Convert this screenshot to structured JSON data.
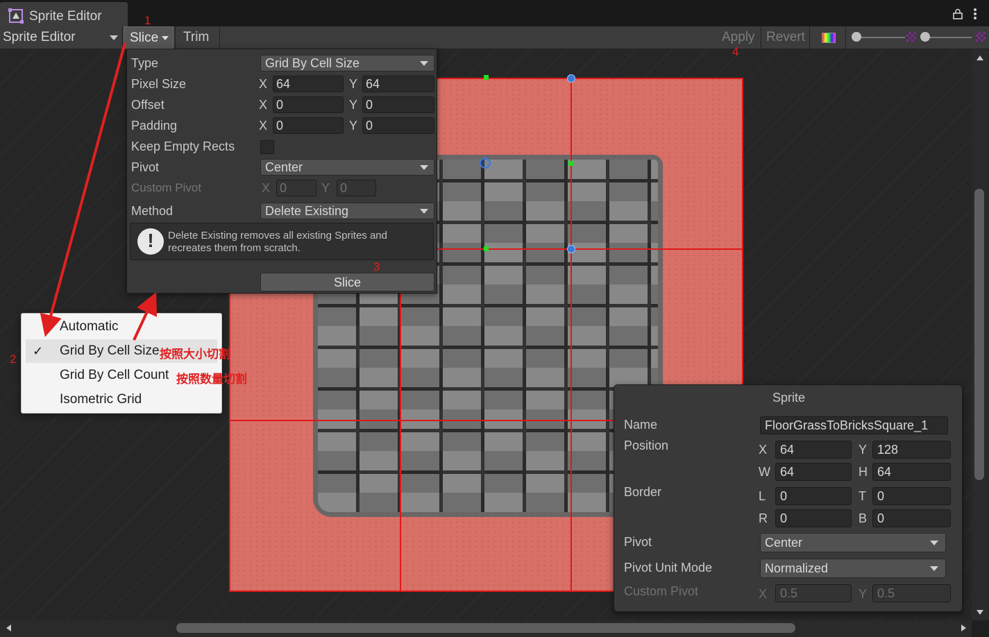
{
  "window": {
    "title": "Sprite Editor",
    "title_icon": "sprite-editor-icon",
    "lock_icon": "lock-icon",
    "more_icon": "more-vertical-icon"
  },
  "toolbar": {
    "mode": "Sprite Editor",
    "slice_label": "Slice",
    "trim_label": "Trim",
    "apply_label": "Apply",
    "revert_label": "Revert",
    "color_icon": "color-channel-icon",
    "mip_icon": "mipmap-icon"
  },
  "slice_panel": {
    "type_label": "Type",
    "type_value": "Grid By Cell Size",
    "pixel_size_label": "Pixel Size",
    "pixel_size": {
      "x_label": "X",
      "x": "64",
      "y_label": "Y",
      "y": "64"
    },
    "offset_label": "Offset",
    "offset": {
      "x_label": "X",
      "x": "0",
      "y_label": "Y",
      "y": "0"
    },
    "padding_label": "Padding",
    "padding": {
      "x_label": "X",
      "x": "0",
      "y_label": "Y",
      "y": "0"
    },
    "keep_empty_label": "Keep Empty Rects",
    "keep_empty_checked": false,
    "pivot_label": "Pivot",
    "pivot_value": "Center",
    "custom_pivot_label": "Custom Pivot",
    "custom_pivot": {
      "x_label": "X",
      "x": "0",
      "y_label": "Y",
      "y": "0"
    },
    "method_label": "Method",
    "method_value": "Delete Existing",
    "help_text": "Delete Existing removes all existing Sprites and recreates them from scratch.",
    "help_icon": "warning-icon",
    "slice_button": "Slice"
  },
  "type_menu": {
    "items": [
      "Automatic",
      "Grid By Cell Size",
      "Grid By Cell Count",
      "Isometric Grid"
    ],
    "selected": "Grid By Cell Size",
    "check_glyph": "✓"
  },
  "sprite_panel": {
    "title": "Sprite",
    "name_label": "Name",
    "name_value": "FloorGrassToBricksSquare_1",
    "position_label": "Position",
    "position": {
      "x_label": "X",
      "x": "64",
      "y_label": "Y",
      "y": "128",
      "w_label": "W",
      "w": "64",
      "h_label": "H",
      "h": "64"
    },
    "border_label": "Border",
    "border": {
      "l_label": "L",
      "l": "0",
      "t_label": "T",
      "t": "0",
      "r_label": "R",
      "r": "0",
      "b_label": "B",
      "b": "0"
    },
    "pivot_label": "Pivot",
    "pivot_value": "Center",
    "pivot_unit_label": "Pivot Unit Mode",
    "pivot_unit_value": "Normalized",
    "custom_pivot_label": "Custom Pivot",
    "custom_pivot": {
      "x_label": "X",
      "x": "0.5",
      "y_label": "Y",
      "y": "0.5"
    }
  },
  "annotations": {
    "n1": "1",
    "n2": "2",
    "n3": "3",
    "n4": "4",
    "by_size": "按照大小切割",
    "by_count": "按照数量切割",
    "color": "#e02020"
  },
  "colors": {
    "slice_grid": "#e01818",
    "sprite_bg": "#d87068",
    "handle": "#3a78d8",
    "handle_green": "#22dd22"
  }
}
